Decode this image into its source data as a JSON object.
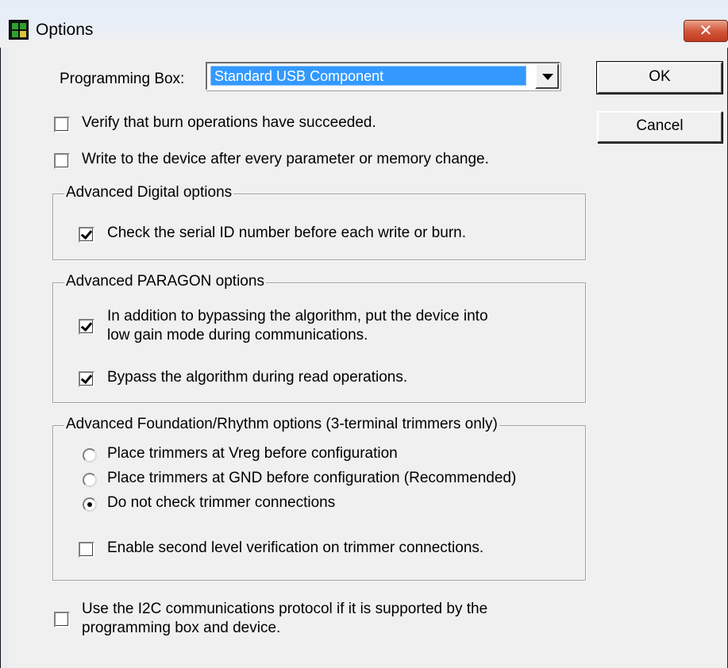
{
  "window": {
    "title": "Options",
    "close_label": "✕"
  },
  "programming_box": {
    "label": "Programming Box:",
    "value": "Standard USB Component"
  },
  "buttons": {
    "ok": "OK",
    "cancel": "Cancel"
  },
  "options": {
    "verify_burn": {
      "label": "Verify that burn operations have succeeded.",
      "checked": false
    },
    "write_after_change": {
      "label": "Write to the device after every parameter or memory change.",
      "checked": false
    }
  },
  "digital_group": {
    "title": "Advanced Digital options",
    "check_serial": {
      "label": "Check the serial ID number before each write or burn.",
      "checked": true
    }
  },
  "paragon_group": {
    "title": "Advanced PARAGON options",
    "low_gain": {
      "line1": "In addition to bypassing the algorithm, put the device into",
      "line2": "low gain mode during communications.",
      "checked": true
    },
    "bypass_read": {
      "label": "Bypass the algorithm during read operations.",
      "checked": true
    }
  },
  "foundation_group": {
    "title": "Advanced Foundation/Rhythm options (3-terminal trimmers only)",
    "radios": [
      {
        "label": "Place trimmers at Vreg before configuration",
        "selected": false
      },
      {
        "label": "Place trimmers at GND before configuration (Recommended)",
        "selected": false
      },
      {
        "label": "Do not check trimmer connections",
        "selected": true
      }
    ],
    "second_level": {
      "label": "Enable second level verification on trimmer connections.",
      "checked": false
    }
  },
  "i2c": {
    "line1": "Use the I2C communications protocol if it is supported by the",
    "line2": "programming box and device.",
    "checked": false
  },
  "colors": {
    "selection": "#3399ff",
    "dialog_bg": "#f0f0f0",
    "close_red": "#c13a1e"
  }
}
